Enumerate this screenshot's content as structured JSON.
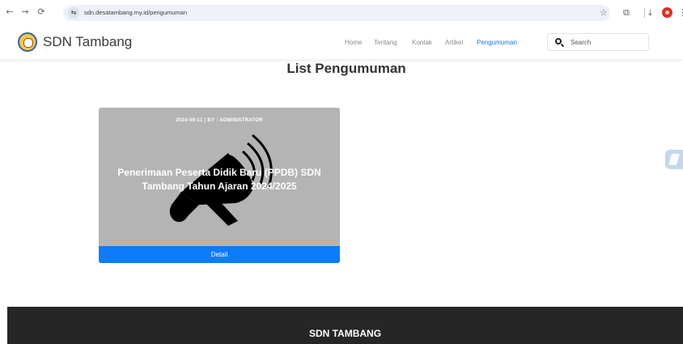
{
  "browser": {
    "url": "sdn.desatambang.my.id/pengumuman",
    "back_icon": "←",
    "forward_icon": "→",
    "reload_icon": "⟳",
    "tune_icon": "⇆",
    "star_icon": "☆",
    "extensions_icon": "⧉",
    "download_icon": "⤓",
    "menu_icon": "⋮"
  },
  "header": {
    "brand": "SDN Tambang",
    "nav": [
      "Home",
      "Tentang",
      "Kontak",
      "Artikel",
      "Pengumuman"
    ],
    "active_nav": "Pengumuman",
    "search_placeholder": "Search"
  },
  "main": {
    "title": "List Pengumuman",
    "announcements": [
      {
        "meta": "2024-09-11 | BY : ADMINISTRATOR",
        "title": "Penerimaan Peserta Didik Baru (PPDB) SDN Tambang Tahun Ajaran 2024/2025",
        "button": "Detail",
        "image_icon": "megaphone-icon"
      }
    ]
  },
  "footer": {
    "title": "SDN TAMBANG"
  },
  "colors": {
    "accent": "#0d7cf8",
    "active_nav": "#1a73e8",
    "card_bg": "#b4b4b4",
    "footer_bg": "#262626"
  }
}
